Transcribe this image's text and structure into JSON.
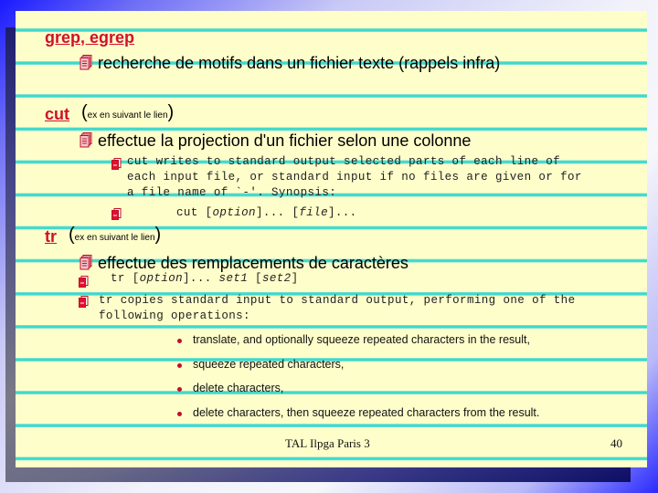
{
  "slide": {
    "sections": {
      "grep": {
        "title": "grep, egrep",
        "items": [
          {
            "icon": "document-stack-icon",
            "text": "recherche de motifs dans un fichier texte  (rappels infra)"
          }
        ]
      },
      "cut": {
        "title": "cut",
        "note": "ex en suivant le lien",
        "items": [
          {
            "icon": "document-stack-icon",
            "text": "effectue la projection d'un fichier selon une colonne"
          }
        ],
        "subitems": [
          {
            "icon": "document-icon",
            "lines": [
              "cut writes to standard output selected parts of each line of",
              "each input file, or standard input if no files are given or for",
              "a file name of `-'. Synopsis:"
            ]
          },
          {
            "icon": "document-icon",
            "synopsis": {
              "cmd": "cut [",
              "opt": "option",
              "mid": "]... [",
              "file": "file",
              "end": "]..."
            }
          }
        ]
      },
      "tr": {
        "title": "tr",
        "note": "ex en suivant le lien",
        "items": [
          {
            "icon": "document-stack-icon",
            "text": "effectue des remplacements de caractères"
          }
        ],
        "subitems": [
          {
            "icon": "document-icon",
            "synopsis": {
              "cmd": "tr [",
              "opt": "option",
              "mid": "]... ",
              "set1": "set1",
              "sp": " [",
              "set2": "set2",
              "end": "]"
            }
          },
          {
            "icon": "document-icon",
            "lines": [
              "tr copies standard input to standard output, performing one of the",
              "following operations:"
            ]
          }
        ],
        "bullets": [
          "translate, and optionally squeeze repeated characters in the result,",
          "squeeze repeated characters,",
          "delete characters,",
          "delete characters, then squeeze repeated characters from the result."
        ]
      }
    },
    "footer": {
      "center": "TAL Ilpga Paris 3",
      "page_number": "40"
    },
    "colors": {
      "heading": "#d0102a",
      "paper": "#fefecb",
      "rule": "#3fd9cc",
      "bullet": "#c0102a"
    }
  }
}
